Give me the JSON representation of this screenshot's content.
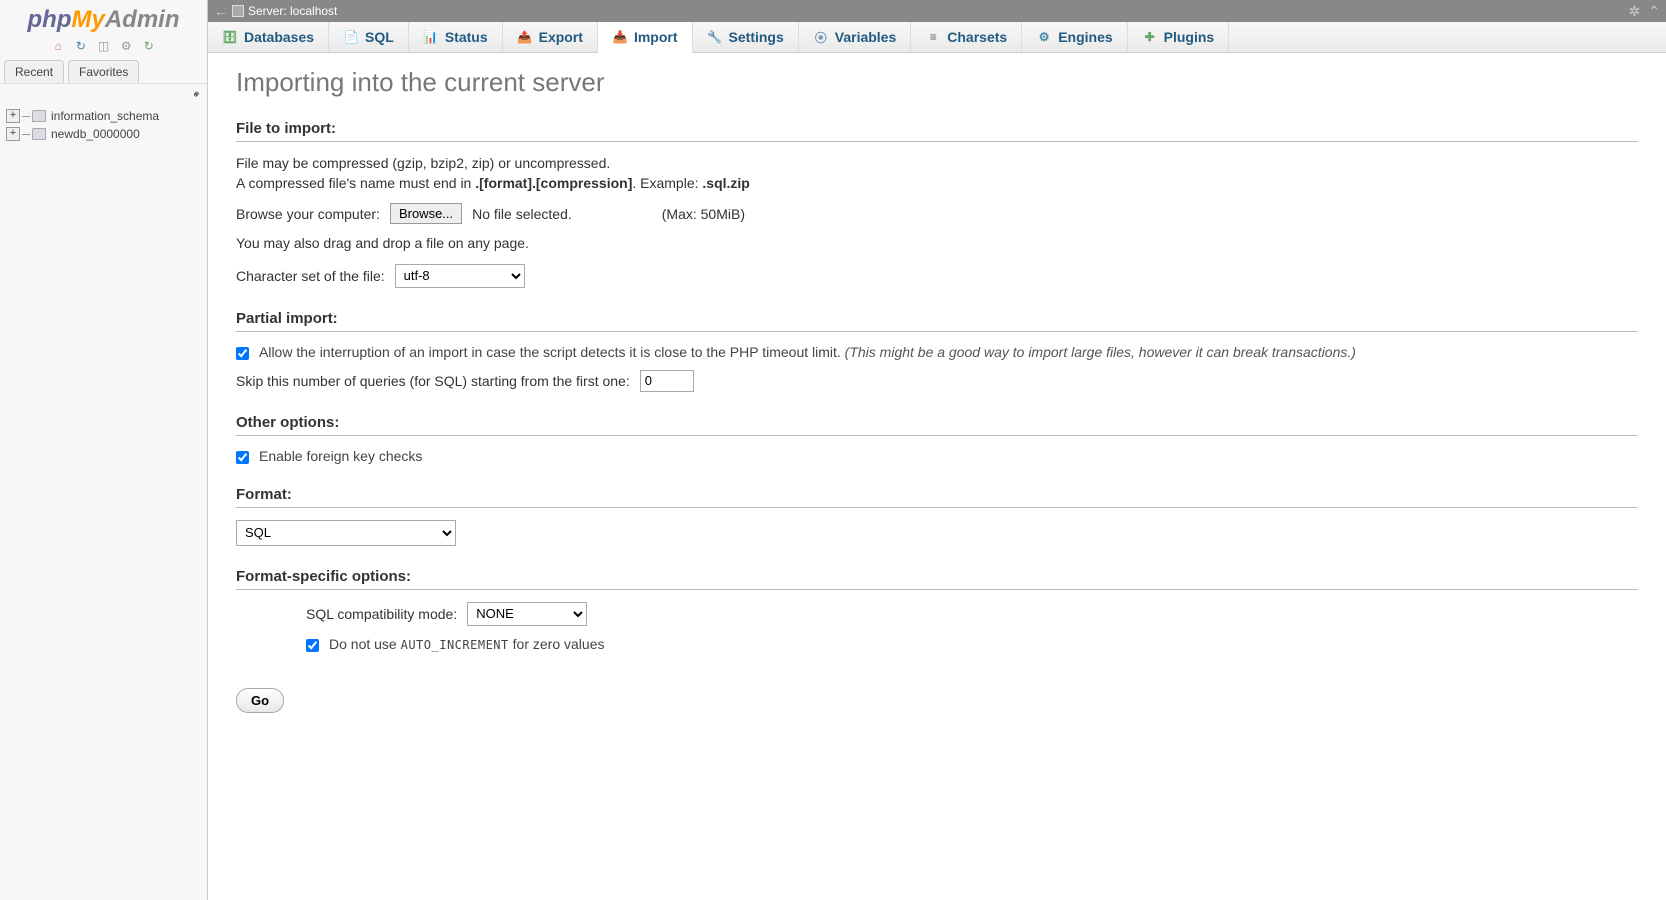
{
  "sidebar": {
    "logo_php": "php",
    "logo_my": "My",
    "logo_admin": "Admin",
    "tabs": {
      "recent": "Recent",
      "favorites": "Favorites"
    },
    "databases": [
      "information_schema",
      "newdb_0000000"
    ]
  },
  "topbar": {
    "server_label": "Server: localhost"
  },
  "tabs": [
    {
      "key": "databases",
      "label": "Databases",
      "icon": "🗄",
      "color": "#6a6"
    },
    {
      "key": "sql",
      "label": "SQL",
      "icon": "📄",
      "color": "#48a"
    },
    {
      "key": "status",
      "label": "Status",
      "icon": "📊",
      "color": "#6a6"
    },
    {
      "key": "export",
      "label": "Export",
      "icon": "📤",
      "color": "#a66"
    },
    {
      "key": "import",
      "label": "Import",
      "icon": "📥",
      "color": "#a66",
      "active": true
    },
    {
      "key": "settings",
      "label": "Settings",
      "icon": "🔧",
      "color": "#79b"
    },
    {
      "key": "variables",
      "label": "Variables",
      "icon": "⦿",
      "color": "#79b"
    },
    {
      "key": "charsets",
      "label": "Charsets",
      "icon": "≡",
      "color": "#666"
    },
    {
      "key": "engines",
      "label": "Engines",
      "icon": "⚙",
      "color": "#48a"
    },
    {
      "key": "plugins",
      "label": "Plugins",
      "icon": "✚",
      "color": "#6a6"
    }
  ],
  "page": {
    "title": "Importing into the current server",
    "sections": {
      "file": {
        "heading": "File to import:",
        "help1": "File may be compressed (gzip, bzip2, zip) or uncompressed.",
        "help2_pre": "A compressed file's name must end in ",
        "help2_bold1": ".[format].[compression]",
        "help2_mid": ". Example: ",
        "help2_bold2": ".sql.zip",
        "browse_label": "Browse your computer:",
        "browse_btn": "Browse...",
        "no_file": "No file selected.",
        "max": "(Max: 50MiB)",
        "drag_hint": "You may also drag and drop a file on any page.",
        "charset_label": "Character set of the file:",
        "charset_value": "utf-8"
      },
      "partial": {
        "heading": "Partial import:",
        "allow_interrupt": "Allow the interruption of an import in case the script detects it is close to the PHP timeout limit.",
        "allow_interrupt_hint": "(This might be a good way to import large files, however it can break transactions.)",
        "skip_label": "Skip this number of queries (for SQL) starting from the first one:",
        "skip_value": "0"
      },
      "other": {
        "heading": "Other options:",
        "fk_label": "Enable foreign key checks"
      },
      "format": {
        "heading": "Format:",
        "value": "SQL"
      },
      "fso": {
        "heading": "Format-specific options:",
        "compat_label": "SQL compatibility mode:",
        "compat_value": "NONE",
        "noauto_pre": "Do not use ",
        "noauto_code": "AUTO_INCREMENT",
        "noauto_post": " for zero values"
      }
    },
    "go_label": "Go"
  }
}
